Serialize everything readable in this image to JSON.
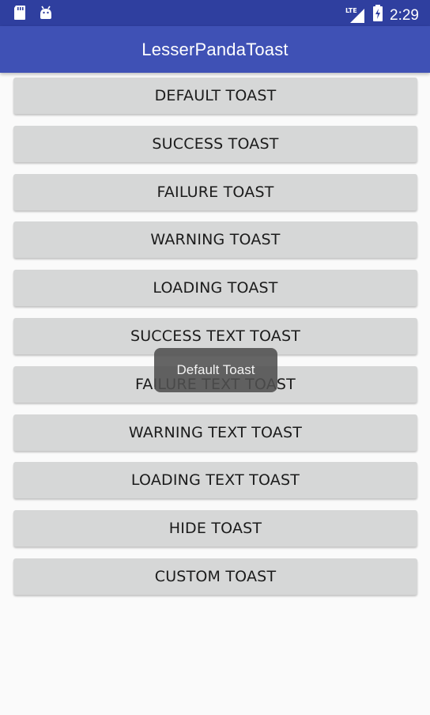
{
  "status_bar": {
    "time": "2:29",
    "network": "LTE",
    "icons": [
      "sd-card-icon",
      "android-icon",
      "signal-icon",
      "battery-charging-icon"
    ]
  },
  "app_bar": {
    "title": "LesserPandaToast"
  },
  "buttons": [
    {
      "label": "DEFAULT TOAST"
    },
    {
      "label": "SUCCESS TOAST"
    },
    {
      "label": "FAILURE TOAST"
    },
    {
      "label": "WARNING TOAST"
    },
    {
      "label": "LOADING TOAST"
    },
    {
      "label": "SUCCESS TEXT TOAST"
    },
    {
      "label": "FAILURE TEXT TOAST"
    },
    {
      "label": "WARNING TEXT TOAST"
    },
    {
      "label": "LOADING TEXT TOAST"
    },
    {
      "label": "HIDE TOAST"
    },
    {
      "label": "CUSTOM TOAST"
    }
  ],
  "toast": {
    "text": "Default Toast"
  },
  "colors": {
    "status_bar": "#2f3f9f",
    "app_bar": "#3f51b5",
    "button_bg": "#d6d7d7",
    "background": "#fafafa"
  }
}
